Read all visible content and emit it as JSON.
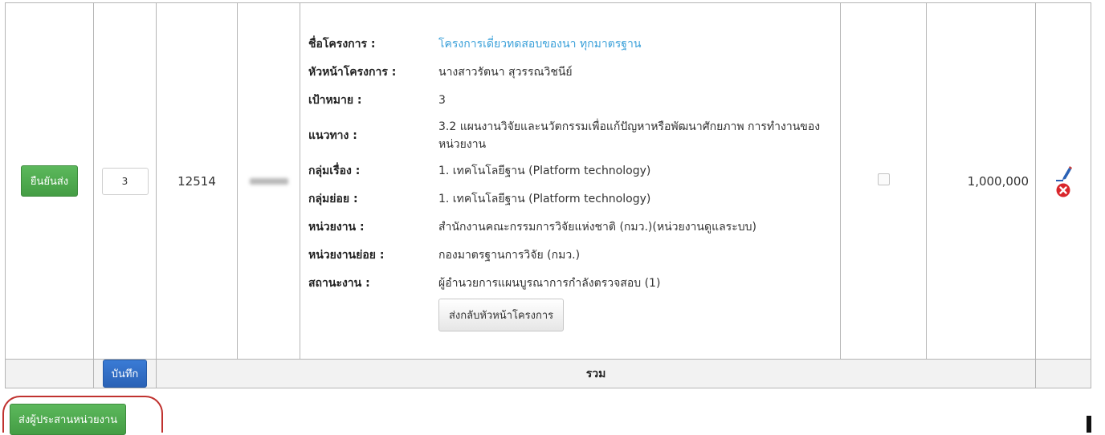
{
  "row": {
    "confirm_label": "ยืนยันส่ง",
    "order_value": "3",
    "project_id": "12514",
    "amount": "1,000,000",
    "return_label": "ส่งกลับหัวหน้าโครงการ",
    "details": [
      {
        "label": "ชื่อโครงการ :",
        "value": "โครงการเดี่ยวทดสอบของนา ทุกมาตรฐาน"
      },
      {
        "label": "หัวหน้าโครงการ :",
        "value": "นางสาวรัตนา สุวรรณวิชนีย์"
      },
      {
        "label": "เป้าหมาย :",
        "value": "3"
      },
      {
        "label": "แนวทาง :",
        "value": "3.2 แผนงานวิจัยและนวัตกรรมเพื่อแก้ปัญหาหรือพัฒนาศักยภาพ การทำงานของหน่วยงาน"
      },
      {
        "label": "กลุ่มเรื่อง :",
        "value": "1. เทคโนโลยีฐาน (Platform technology)"
      },
      {
        "label": "กลุ่มย่อย :",
        "value": "1. เทคโนโลยีฐาน (Platform technology)"
      },
      {
        "label": "หน่วยงาน :",
        "value": "สำนักงานคณะกรรมการวิจัยแห่งชาติ (กมว.)(หน่วยงานดูแลระบบ)"
      },
      {
        "label": "หน่วยงานย่อย :",
        "value": "กองมาตรฐานการวิจัย (กมว.)"
      },
      {
        "label": "สถานะงาน :",
        "value": "ผู้อำนวยการแผนบูรณาการกำลังตรวจสอบ (1)"
      }
    ]
  },
  "footer": {
    "save_label": "บันทึก",
    "total_label": "รวม"
  },
  "submit_label": "ส่งผู้ประสานหน่วยงาน",
  "icons": [
    "edit-pencil-icon",
    "delete-x-icon"
  ],
  "colors": {
    "green": "#5cb85c",
    "blue": "#3a7bd5",
    "link": "#3aa0d9",
    "delete": "#d9262c",
    "highlight": "#c0322f"
  }
}
